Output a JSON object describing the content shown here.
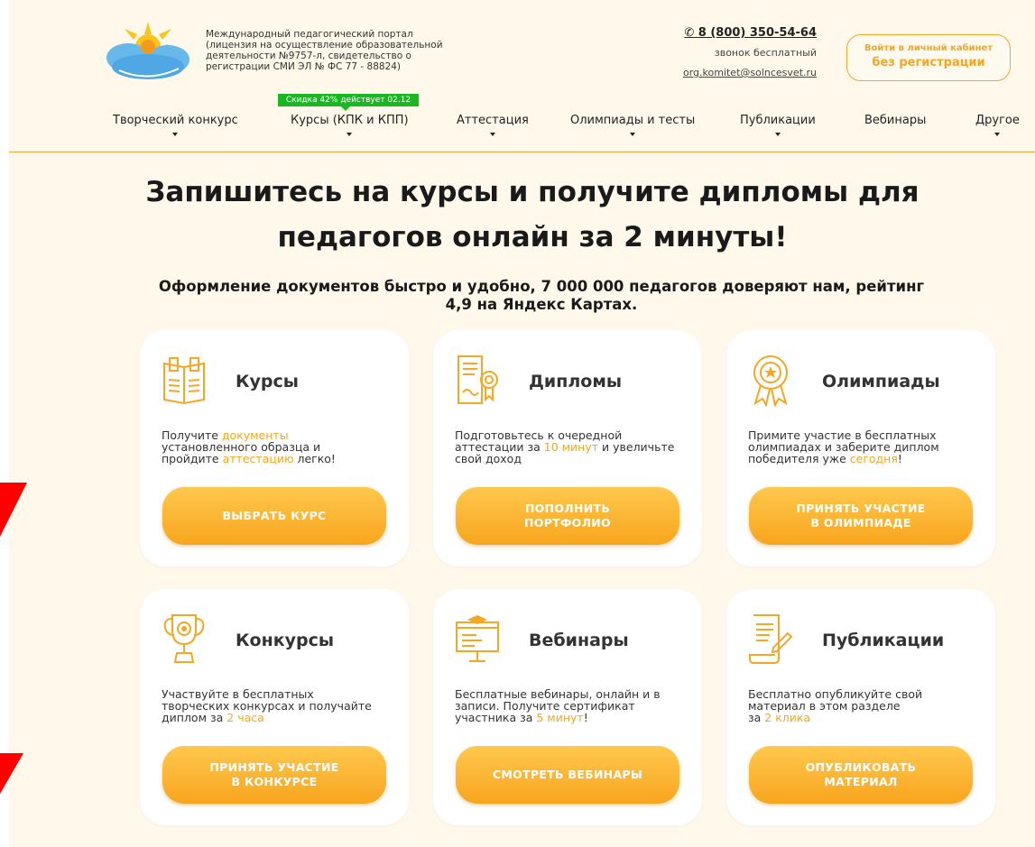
{
  "header": {
    "logo_alt": "Солнечный свет",
    "portal_lines": [
      "Международный педагогический портал",
      "(лицензия на осуществление образовательной",
      "деятельности №9757-л, свидетельство о",
      "регистрации СМИ ЭЛ № ФС 77 - 88824)"
    ],
    "phone": "8 (800) 350-54-64",
    "phone_note": "звонок бесплатный",
    "email": "org.komitet@solncesvet.ru",
    "login_line1": "Войти в личный кабинет",
    "login_line2": "без регистрации",
    "promo": "Скидка 42% действует 02.12"
  },
  "nav": {
    "items": [
      {
        "label": "Творческий конкурс"
      },
      {
        "label": "Курсы (КПК и КПП)"
      },
      {
        "label": "Аттестация"
      },
      {
        "label": "Олимпиады и тесты"
      },
      {
        "label": "Публикации"
      },
      {
        "label": "Вебинары"
      },
      {
        "label": "Другое"
      }
    ]
  },
  "hero": {
    "title_line1": "Запишитесь на курсы и получите дипломы для",
    "title_line2": "педагогов онлайн за 2 минуты!",
    "subtitle_line1": "Оформление документов быстро и удобно, 7 000 000 педагогов доверяют нам, рейтинг",
    "subtitle_line2": "4,9 на Яндекс Картах."
  },
  "cards": [
    {
      "title": "Курсы",
      "icon": "book-icon",
      "desc": [
        [
          {
            "t": "Получите "
          },
          {
            "t": "документы",
            "h": true
          }
        ],
        [
          {
            "t": "установленного образца и"
          }
        ],
        [
          {
            "t": "пройдите "
          },
          {
            "t": "аттестацию",
            "h": true
          },
          {
            "t": " легко!"
          }
        ]
      ],
      "button": [
        "ВЫБРАТЬ КУРС"
      ]
    },
    {
      "title": "Дипломы",
      "icon": "diploma-icon",
      "desc": [
        [
          {
            "t": "Подготовьтесь к очередной"
          }
        ],
        [
          {
            "t": "аттестации за "
          },
          {
            "t": "10 минут",
            "h": true
          },
          {
            "t": " и увеличьте"
          }
        ],
        [
          {
            "t": "свой доход"
          }
        ]
      ],
      "button": [
        "ПОПОЛНИТЬ",
        "ПОРТФОЛИО"
      ]
    },
    {
      "title": "Олимпиады",
      "icon": "medal-icon",
      "desc": [
        [
          {
            "t": "Примите участие в бесплатных"
          }
        ],
        [
          {
            "t": "олимпиадах и заберите диплом"
          }
        ],
        [
          {
            "t": "победителя уже "
          },
          {
            "t": "сегодня",
            "h": true
          },
          {
            "t": "!"
          }
        ]
      ],
      "button": [
        "ПРИНЯТЬ УЧАСТИЕ",
        "В ОЛИМПИАДЕ"
      ]
    },
    {
      "title": "Конкурсы",
      "icon": "trophy-icon",
      "desc": [
        [
          {
            "t": "Участвуйте в бесплатных"
          }
        ],
        [
          {
            "t": "творческих конкурсах и получайте"
          }
        ],
        [
          {
            "t": "диплом за "
          },
          {
            "t": "2 часа",
            "h": true
          }
        ]
      ],
      "button": [
        "ПРИНЯТЬ УЧАСТИЕ",
        "В КОНКУРСЕ"
      ]
    },
    {
      "title": "Вебинары",
      "icon": "monitor-icon",
      "desc": [
        [
          {
            "t": "Бесплатные вебинары, онлайн и в"
          }
        ],
        [
          {
            "t": "записи. Получите сертификат"
          }
        ],
        [
          {
            "t": "участника за "
          },
          {
            "t": "5 минут",
            "h": true
          },
          {
            "t": "!"
          }
        ]
      ],
      "button": [
        "СМОТРЕТЬ ВЕБИНАРЫ"
      ]
    },
    {
      "title": "Публикации",
      "icon": "scroll-pen-icon",
      "desc": [
        [
          {
            "t": "Бесплатно опубликуйте свой"
          }
        ],
        [
          {
            "t": "материал в этом разделе"
          }
        ],
        [
          {
            "t": "за "
          },
          {
            "t": "2 клика",
            "h": true
          }
        ]
      ],
      "button": [
        "ОПУБЛИКОВАТЬ",
        "МАТЕРИАЛ"
      ]
    }
  ],
  "colors": {
    "accent": "#f5a623",
    "page_bg": "#fff8eb",
    "promo_green": "#18b820",
    "pointer_red": "#ff0000"
  }
}
